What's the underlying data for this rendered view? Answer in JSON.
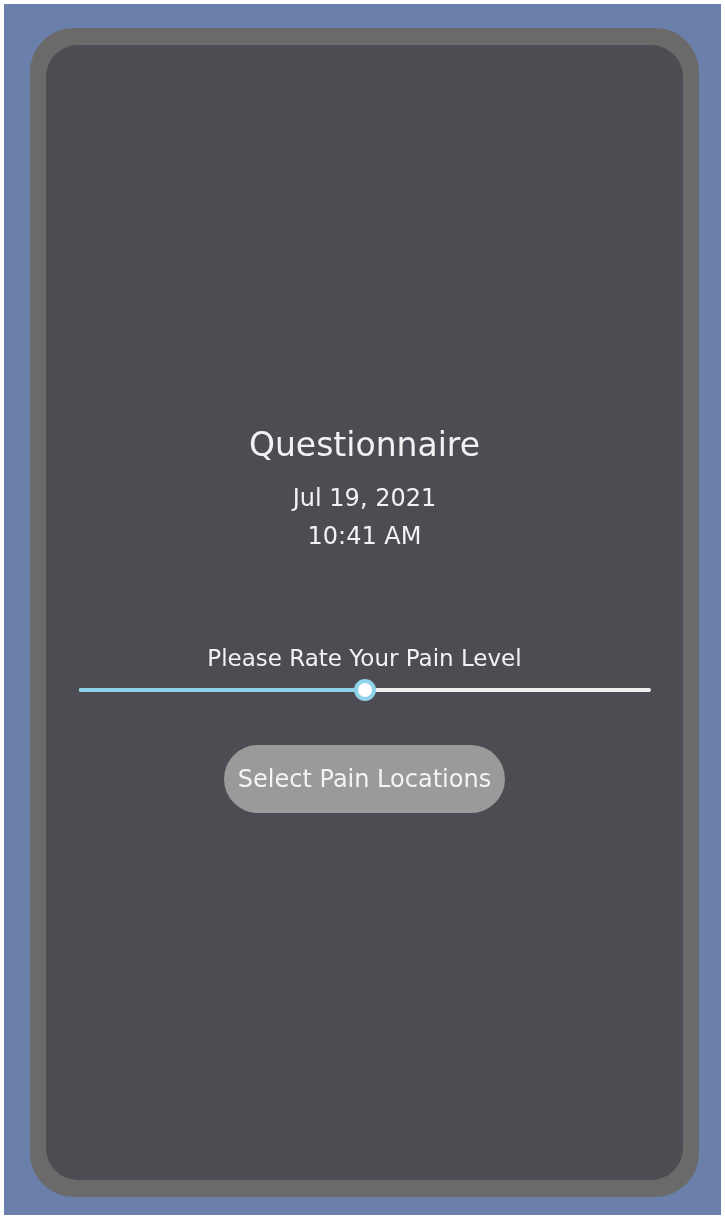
{
  "title": "Questionnaire",
  "date": "Jul 19, 2021",
  "time": "10:41 AM",
  "slider": {
    "label": "Please Rate Your Pain Level",
    "level": 0.5
  },
  "button": {
    "label": "Select Pain Locations"
  }
}
